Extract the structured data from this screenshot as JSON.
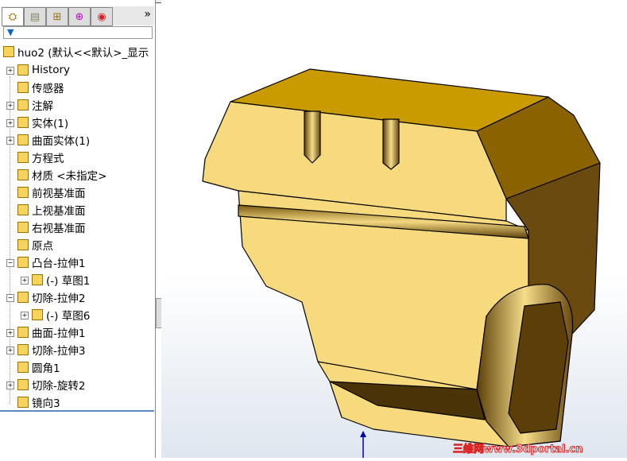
{
  "tabs": [
    {
      "name": "feature-manager",
      "icon": "feature-tree-icon"
    },
    {
      "name": "property-manager",
      "icon": "property-icon"
    },
    {
      "name": "configuration-manager",
      "icon": "configuration-icon"
    },
    {
      "name": "dimxpert",
      "icon": "crosshair-icon"
    },
    {
      "name": "display-manager",
      "icon": "appearance-icon"
    }
  ],
  "more": "»",
  "filter_icon": "▼",
  "root": "huo2  (默认<<默认>_显示",
  "items": [
    {
      "label": "History",
      "expand": true,
      "indent": 0
    },
    {
      "label": "传感器",
      "expand": false,
      "indent": 0
    },
    {
      "label": "注解",
      "expand": true,
      "indent": 0
    },
    {
      "label": "实体(1)",
      "expand": true,
      "indent": 0
    },
    {
      "label": "曲面实体(1)",
      "expand": true,
      "indent": 0
    },
    {
      "label": "方程式",
      "expand": false,
      "indent": 0
    },
    {
      "label": "材质 <未指定>",
      "expand": false,
      "indent": 0
    },
    {
      "label": "前视基准面",
      "expand": false,
      "indent": 0
    },
    {
      "label": "上视基准面",
      "expand": false,
      "indent": 0
    },
    {
      "label": "右视基准面",
      "expand": false,
      "indent": 0
    },
    {
      "label": "原点",
      "expand": false,
      "indent": 0
    },
    {
      "label": "凸台-拉伸1",
      "expand": "open",
      "indent": 0
    },
    {
      "label": "(-) 草图1",
      "expand": true,
      "indent": 1
    },
    {
      "label": "切除-拉伸2",
      "expand": "open",
      "indent": 0
    },
    {
      "label": "(-) 草图6",
      "expand": true,
      "indent": 1
    },
    {
      "label": "曲面-拉伸1",
      "expand": true,
      "indent": 0
    },
    {
      "label": "切除-拉伸3",
      "expand": true,
      "indent": 0
    },
    {
      "label": "圆角1",
      "expand": false,
      "indent": 0
    },
    {
      "label": "切除-旋转2",
      "expand": true,
      "indent": 0
    },
    {
      "label": "镜向3",
      "expand": false,
      "indent": 0
    }
  ],
  "watermark": "三维网www.3dportal.cn",
  "colors": {
    "top": "#c99b00",
    "front": "#f8da7e",
    "right": "#8a6300",
    "shadow": "#5c3f08",
    "accent": "#5b8ac0"
  }
}
